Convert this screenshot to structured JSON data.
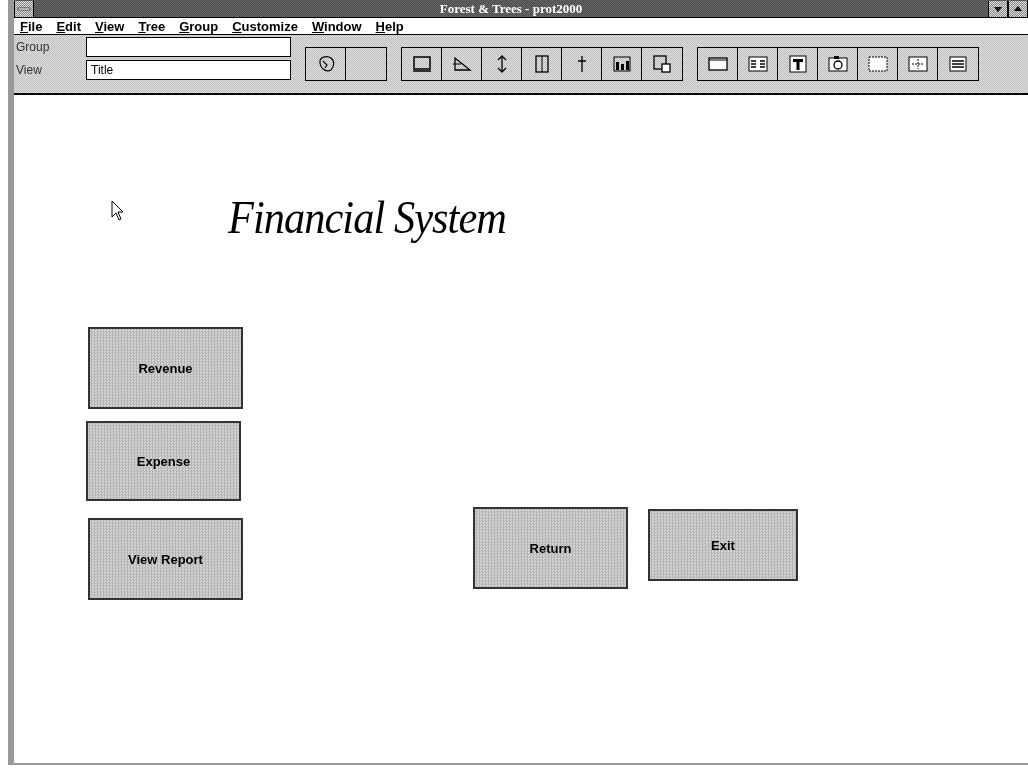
{
  "window": {
    "title": "Forest & Trees - prot2000"
  },
  "menu": [
    {
      "label": "File"
    },
    {
      "label": "Edit"
    },
    {
      "label": "View"
    },
    {
      "label": "Tree"
    },
    {
      "label": "Group"
    },
    {
      "label": "Customize"
    },
    {
      "label": "Window"
    },
    {
      "label": "Help"
    }
  ],
  "toolbar": {
    "fields": [
      {
        "label": "Group"
      },
      {
        "label": "View",
        "value": "Title"
      }
    ]
  },
  "canvas": {
    "heading": "Financial System",
    "buttons": [
      {
        "label": "Revenue"
      },
      {
        "label": "Expense"
      },
      {
        "label": "View Report"
      },
      {
        "label": "Return"
      },
      {
        "label": "Exit"
      }
    ]
  }
}
